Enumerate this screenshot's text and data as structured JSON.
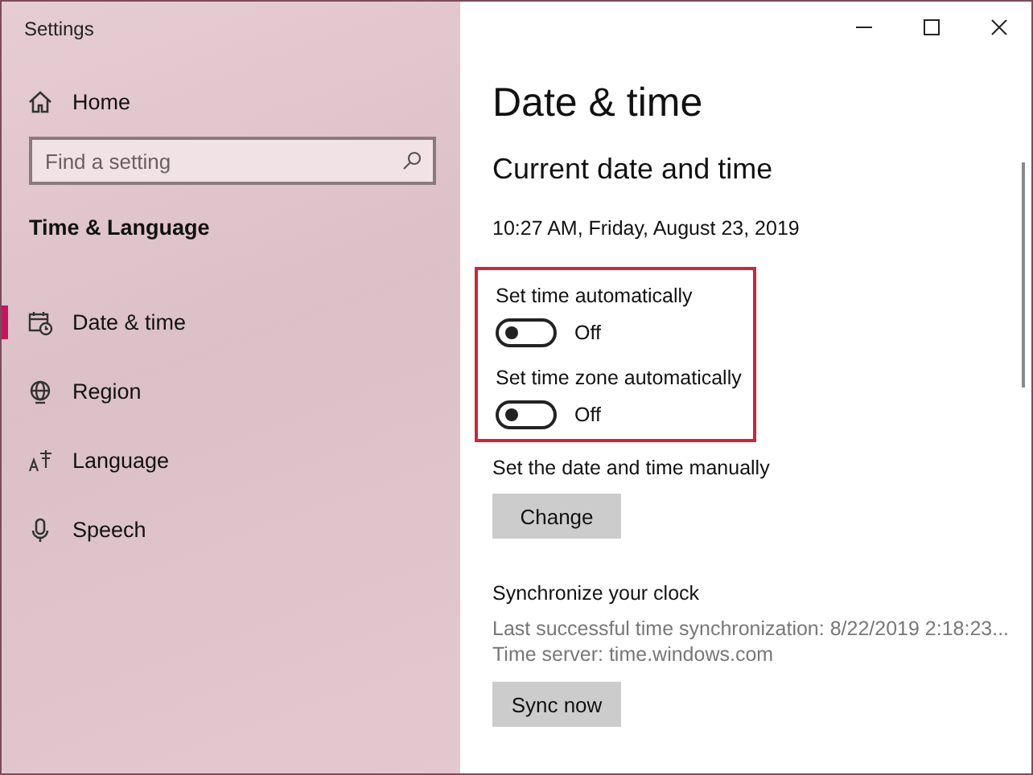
{
  "window": {
    "title": "Settings"
  },
  "sidebar": {
    "home": "Home",
    "search": {
      "placeholder": "Find a setting"
    },
    "section_title": "Time & Language",
    "items": [
      {
        "label": "Date & time",
        "selected": true
      },
      {
        "label": "Region",
        "selected": false
      },
      {
        "label": "Language",
        "selected": false
      },
      {
        "label": "Speech",
        "selected": false
      }
    ]
  },
  "content": {
    "title": "Date & time",
    "section_title": "Current date and time",
    "current_datetime": "10:27 AM, Friday, August 23, 2019",
    "toggles": [
      {
        "label": "Set time automatically",
        "on": false,
        "state_text": "Off"
      },
      {
        "label": "Set time zone automatically",
        "on": false,
        "state_text": "Off"
      }
    ],
    "manual": {
      "label": "Set the date and time manually",
      "button": "Change"
    },
    "sync": {
      "title": "Synchronize your clock",
      "last_sync": "Last successful time synchronization: 8/22/2019 2:18:23...",
      "server": "Time server: time.windows.com",
      "button": "Sync now"
    }
  }
}
